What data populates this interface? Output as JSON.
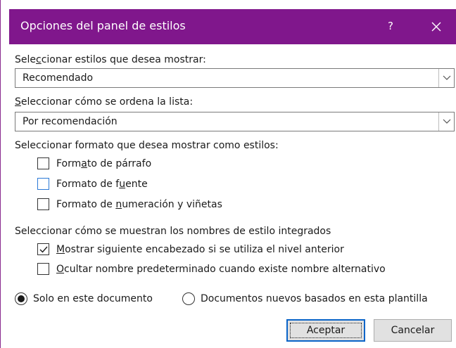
{
  "dialog": {
    "title": "Opciones del panel de estilos",
    "help_label": "?",
    "title_bar_color": "#80178c"
  },
  "styles_to_show": {
    "label_pre": "Sele",
    "label_key": "c",
    "label_post": "cionar estilos que desea mostrar:",
    "value": "Recomendado"
  },
  "sort_order": {
    "label_key": "S",
    "label_post": "eleccionar cómo se ordena la lista:",
    "value": "Por recomendación"
  },
  "format_group": {
    "label": "Seleccionar formato que desea mostrar como estilos:",
    "items": [
      {
        "pre": "Form",
        "key": "a",
        "post": "to de párrafo",
        "checked": false
      },
      {
        "pre": "Formato de f",
        "key": "u",
        "post": "ente",
        "checked": false
      },
      {
        "pre": "Formato de ",
        "key": "n",
        "post": "umeración y viñetas",
        "checked": false
      }
    ]
  },
  "builtin_names_group": {
    "label": "Seleccionar cómo se muestran los nombres de estilo integrados",
    "items": [
      {
        "pre": "",
        "key": "M",
        "post": "ostrar siguiente encabezado si se utiliza el nivel anterior",
        "checked": true
      },
      {
        "pre": "",
        "key": "O",
        "post": "cultar nombre predeterminado cuando existe nombre alternativo",
        "checked": false
      }
    ]
  },
  "scope": {
    "options": [
      {
        "label": "Solo en este documento",
        "selected": true
      },
      {
        "label": "Documentos nuevos basados en esta plantilla",
        "selected": false
      }
    ]
  },
  "buttons": {
    "ok": "Aceptar",
    "cancel": "Cancelar"
  },
  "icons": {
    "close": "close-icon",
    "dropdown": "chevron-down-icon",
    "check": "check-icon"
  }
}
